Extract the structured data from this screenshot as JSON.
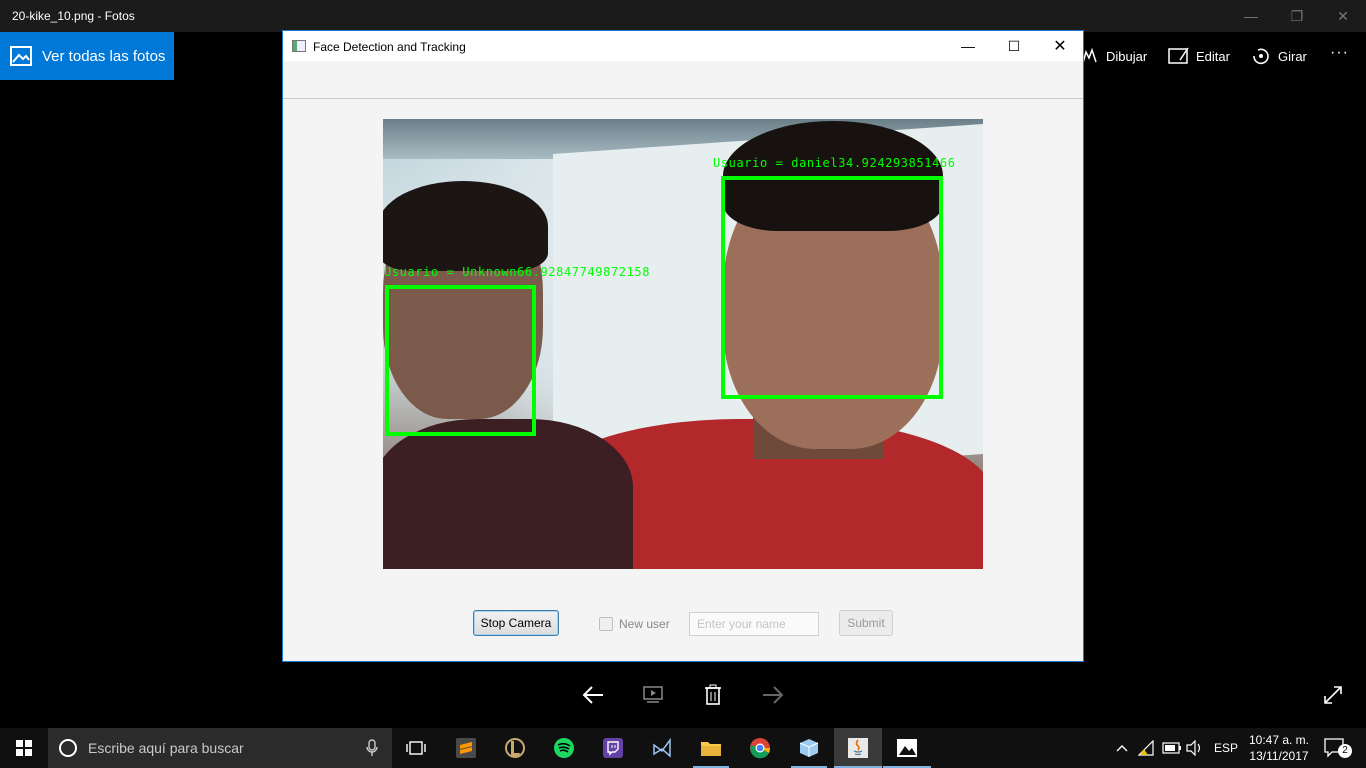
{
  "photos": {
    "window_title": "20-kike_10.png - Fotos",
    "see_all_label": "Ver todas las fotos",
    "actions": {
      "draw": "Dibujar",
      "edit": "Editar",
      "rotate": "Girar",
      "more": "···"
    }
  },
  "app_window": {
    "title": "Face Detection and Tracking",
    "faces": [
      {
        "label": "Usuario = Unknown66.92847749872158"
      },
      {
        "label": "Usuario = daniel34.924293851466"
      }
    ],
    "controls": {
      "stop_camera": "Stop Camera",
      "new_user_label": "New user",
      "new_user_checked": false,
      "name_placeholder": "Enter your name",
      "name_value": "",
      "submit": "Submit"
    }
  },
  "taskbar": {
    "search_placeholder": "Escribe aquí para buscar",
    "language": "ESP",
    "time": "10:47 a. m.",
    "date": "13/11/2017",
    "notification_count": "2"
  },
  "colors": {
    "accent": "#0078d7",
    "face_box": "#00ff00",
    "window_border": "#1c78d4"
  }
}
